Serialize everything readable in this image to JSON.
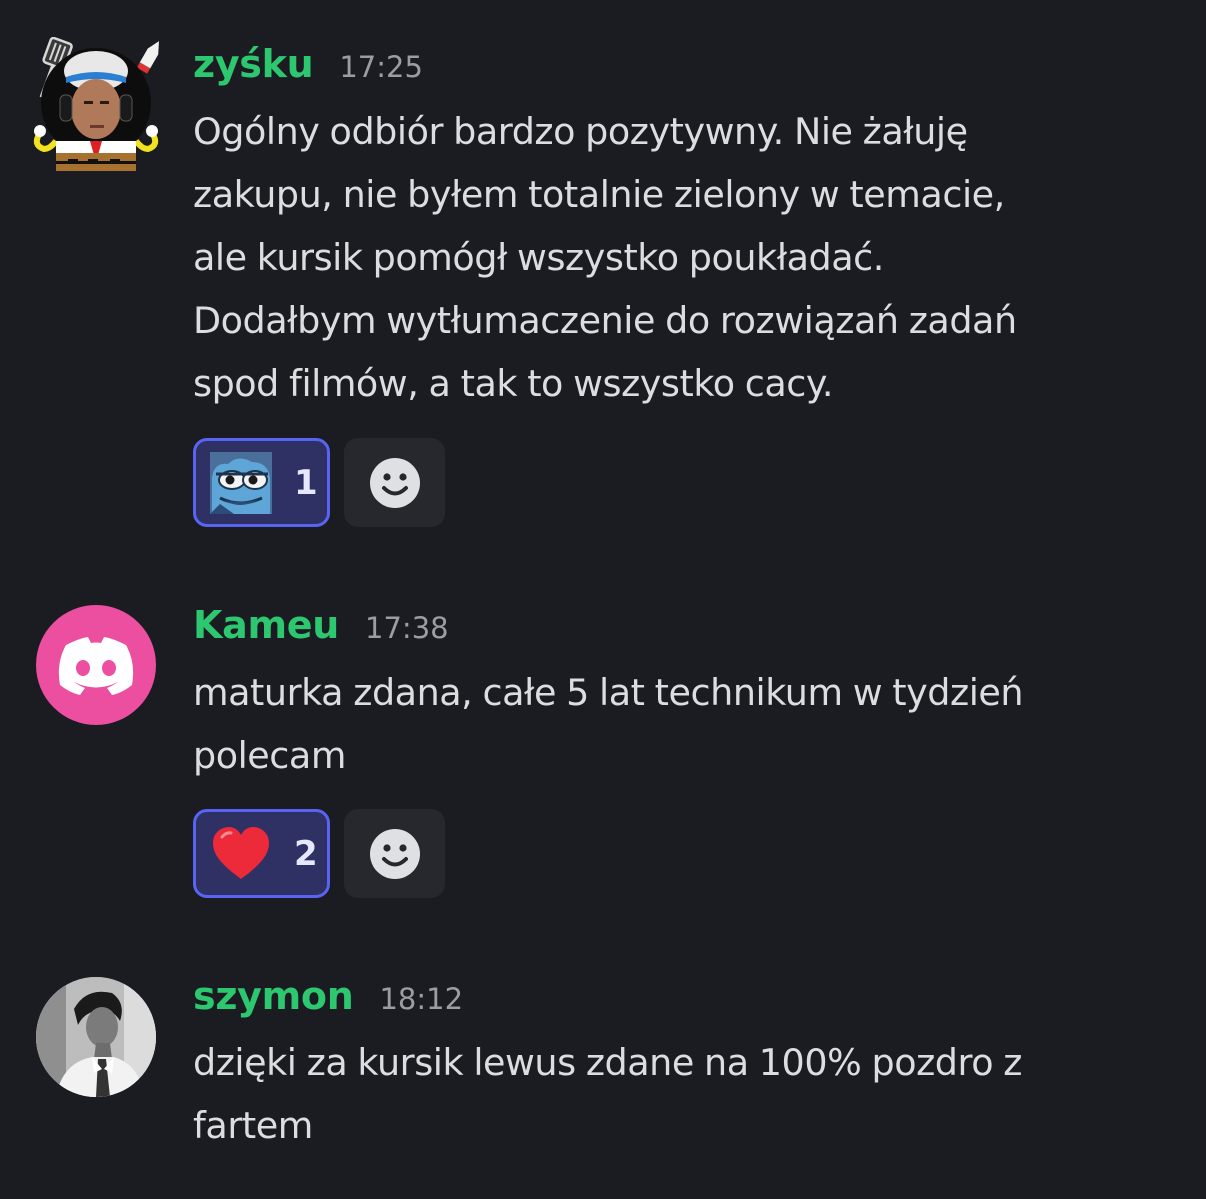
{
  "messages": [
    {
      "username": "zyśku",
      "time": "17:25",
      "text": "Ogólny odbiór bardzo pozytywny. Nie żałuję\nzakupu, nie byłem totalnie zielony w temacie,\nale kursik pomógł wszystko poukładać.\nDodałbym wytłumaczenie do rozwiązań zadań\nspod filmów, a tak to wszystko cacy.",
      "avatar_icon": "spongebob-avatar",
      "reaction": {
        "emoji_name": "pepe-frog-emoji",
        "count": "1"
      }
    },
    {
      "username": "Kameu",
      "time": "17:38",
      "text": "maturka zdana, całe 5 lat technikum w tydzień\npolecam",
      "avatar_icon": "discord-logo-icon",
      "avatar_color": "#ec4ea0",
      "reaction": {
        "emoji": "❤️",
        "emoji_name": "red-heart-emoji",
        "count": "2"
      }
    },
    {
      "username": "szymon",
      "time": "18:12",
      "text": "dzięki za kursik lewus zdane na 100% pozdro z\nfartem",
      "avatar_icon": "portrait-avatar"
    }
  ],
  "colors": {
    "background": "#1b1c21",
    "username": "#2dc770",
    "timestamp": "#9b9da3",
    "text": "#dbdee1",
    "reaction_bg": "#2f3165",
    "reaction_border": "#5865f2",
    "add_reaction_bg": "#27282e"
  }
}
